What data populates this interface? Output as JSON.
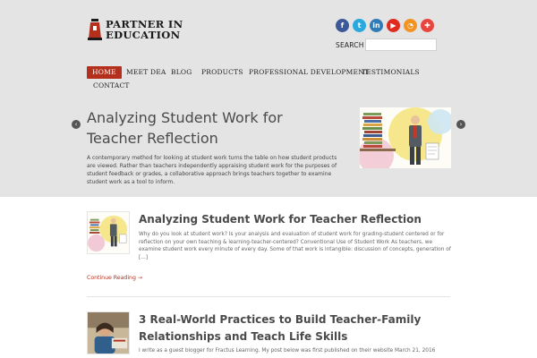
{
  "logo": {
    "line1": "PARTNER IN",
    "line2": "EDUCATION"
  },
  "social": {
    "icons": [
      {
        "name": "facebook-icon",
        "glyph": "f",
        "color": "#3b5998"
      },
      {
        "name": "twitter-icon",
        "glyph": "t",
        "color": "#2aa9e0"
      },
      {
        "name": "linkedin-icon",
        "glyph": "in",
        "color": "#2f7bb6"
      },
      {
        "name": "youtube-icon",
        "glyph": "▶",
        "color": "#e02a20"
      },
      {
        "name": "rss-icon",
        "glyph": "◔",
        "color": "#f39322"
      },
      {
        "name": "cart-icon",
        "glyph": "✚",
        "color": "#e8453c"
      }
    ]
  },
  "search": {
    "label": "SEARCH",
    "placeholder": "",
    "value": ""
  },
  "nav": {
    "items": [
      {
        "label": "HOME",
        "active": true
      },
      {
        "label": "MEET DEA"
      },
      {
        "label": "BLOG"
      },
      {
        "label": "PRODUCTS"
      },
      {
        "label": "PROFESSIONAL DEVELOPMENT"
      },
      {
        "label": "TESTIMONIALS"
      },
      {
        "label": "CONTACT"
      }
    ]
  },
  "slider": {
    "title": "Analyzing Student Work for Teacher Reflection",
    "excerpt": "A contemporary method for looking at student work turns the table on how student products are viewed. Rather than teachers independently appraising student work for the purposes of student feedback or grades, a collaborative approach brings teachers together to examine student work as a tool to inform.",
    "prev_label": "‹",
    "next_label": "›"
  },
  "posts": [
    {
      "title": "Analyzing Student Work for Teacher Reflection",
      "excerpt": "  Why do you look at student work? Is your analysis and evaluation of student work for grading-student centered or for reflection on your own teaching & learning-teacher-centered? Conventional Use of Student Work As teachers, we examine student work every minute of every day. Some of that work is intangible: discussion of concepts, generation of [...]",
      "continue_label": "Continue Reading →"
    },
    {
      "title": "3 Real-World Practices to Build Teacher-Family Relationships and Teach Life Skills",
      "excerpt": "I write as a guest blogger for Fractus Learning. My post below was first published on their website March 21, 2016"
    }
  ],
  "colors": {
    "accent": "#b5301c",
    "band": "#e4e4e4"
  }
}
